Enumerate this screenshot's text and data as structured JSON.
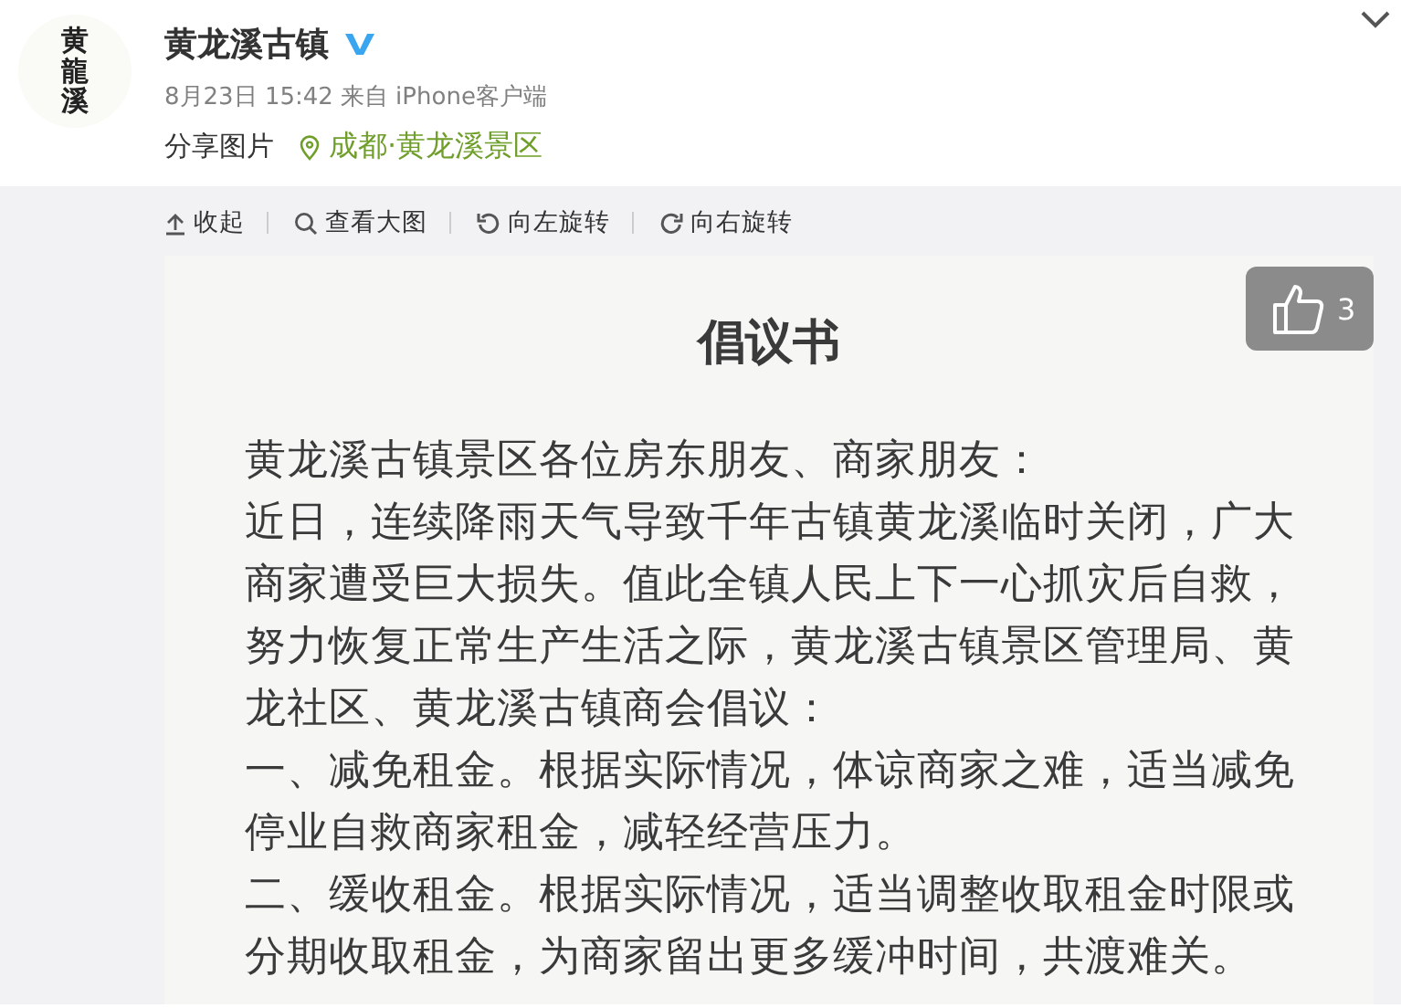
{
  "post": {
    "avatar_text": "黄龍溪",
    "author": "黄龙溪古镇",
    "verified": true,
    "time": "8月23日 15:42",
    "source": "来自 iPhone客户端",
    "text": "分享图片",
    "location": "成都·黄龙溪景区"
  },
  "toolbar": [
    {
      "label": "收起",
      "kind": "collapse"
    },
    {
      "label": "查看大图",
      "kind": "view"
    },
    {
      "label": "向左旋转",
      "kind": "rotateleft"
    },
    {
      "label": "向右旋转",
      "kind": "rotateright"
    }
  ],
  "like": {
    "count": "3"
  },
  "document": {
    "title": "倡议书",
    "lines": [
      "黄龙溪古镇景区各位房东朋友、商家朋友：",
      "近日，连续降雨天气导致千年古镇黄龙溪临时关闭，广大",
      "商家遭受巨大损失。值此全镇人民上下一心抓灾后自救，",
      "努力恢复正常生产生活之际，黄龙溪古镇景区管理局、黄",
      "龙社区、黄龙溪古镇商会倡议：",
      "一、减免租金。根据实际情况，体谅商家之难，适当减免",
      "停业自救商家租金，减轻经营压力。",
      "二、缓收租金。根据实际情况，适当调整收取租金时限或",
      "分期收取租金，为商家留出更多缓冲时间，共渡难关。"
    ]
  }
}
